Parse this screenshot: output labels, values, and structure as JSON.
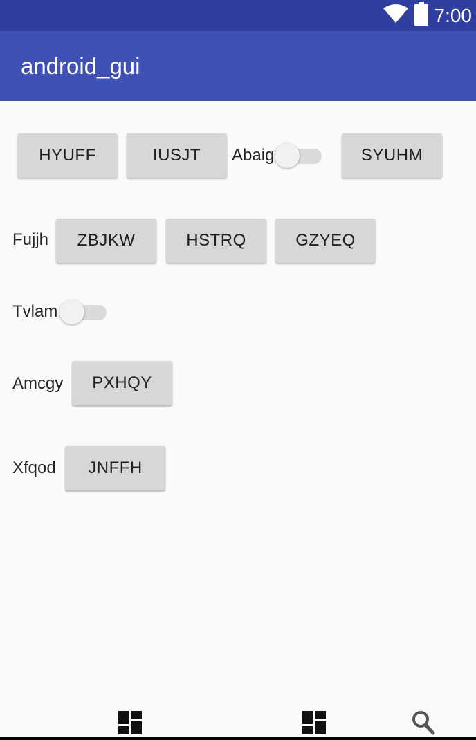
{
  "status_bar": {
    "time": "7:00",
    "icons": [
      "wifi-icon",
      "battery-icon"
    ],
    "background": "#303f9f"
  },
  "app_bar": {
    "title": "android_gui",
    "background": "#3f51b5"
  },
  "rows": {
    "row1": {
      "button_1": "HYUFF",
      "button_2": "IUSJT",
      "switch_label": "Abaig",
      "switch_on": false,
      "button_3": "SYUHM"
    },
    "row2": {
      "label": "Fujjh",
      "button_1": "ZBJKW",
      "button_2": "HSTRQ",
      "button_3": "GZYEQ"
    },
    "row3": {
      "switch_label": "Tvlam",
      "switch_on": false
    },
    "row4": {
      "label": "Amcgy",
      "button_1": "PXHQY"
    },
    "row5": {
      "label": "Xfqod",
      "button_1": "JNFFH"
    }
  },
  "bottom_nav": {
    "icons": [
      "dashboard-icon",
      "dashboard-icon",
      "search-icon"
    ]
  },
  "colors": {
    "button": "#d6d7d7",
    "background": "#fafafa"
  }
}
